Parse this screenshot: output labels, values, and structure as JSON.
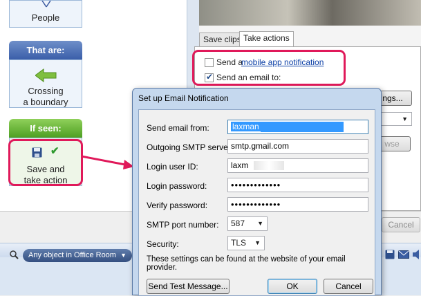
{
  "rules": {
    "people_label": "People",
    "that_are_header": "That are:",
    "crossing_label_line1": "Crossing",
    "crossing_label_line2": "a boundary",
    "if_seen_header": "If seen:",
    "action_label_line1": "Save and",
    "action_label_line2": "take action"
  },
  "tabs": {
    "save_clips": "Save clips",
    "take_actions": "Take actions"
  },
  "take_actions": {
    "send_a_prefix": "Send a",
    "mobile_link": "mobile app notification",
    "mobile_checked": false,
    "send_email_label": "Send an email to:",
    "email_checked": true,
    "settings_button_partial": "ngs...",
    "browse_partial": "wse"
  },
  "bottom": {
    "cancel_label": "Cancel",
    "filter_label": "Any object in Office Room"
  },
  "dialog": {
    "title": "Set up Email Notification",
    "fields": {
      "send_from_label": "Send email from:",
      "send_from_value": "laxman",
      "smtp_server_label": "Outgoing SMTP server:",
      "smtp_server_value": "smtp.gmail.com",
      "login_id_label": "Login user ID:",
      "login_id_value": "laxm",
      "login_password_label": "Login password:",
      "login_password_value": "•••••••••••••",
      "verify_password_label": "Verify password:",
      "verify_password_value": "•••••••••••••",
      "port_label": "SMTP port number:",
      "port_value": "587",
      "security_label": "Security:",
      "security_value": "TLS"
    },
    "info_text": "These settings can be found at the website of your email provider.",
    "send_test_button": "Send Test Message...",
    "ok_button": "OK",
    "cancel_button": "Cancel"
  },
  "colors": {
    "highlight": "#e0195a",
    "link": "#0b3fa6",
    "blue_header": "#3a5ea9",
    "green_header": "#4e9f23"
  }
}
